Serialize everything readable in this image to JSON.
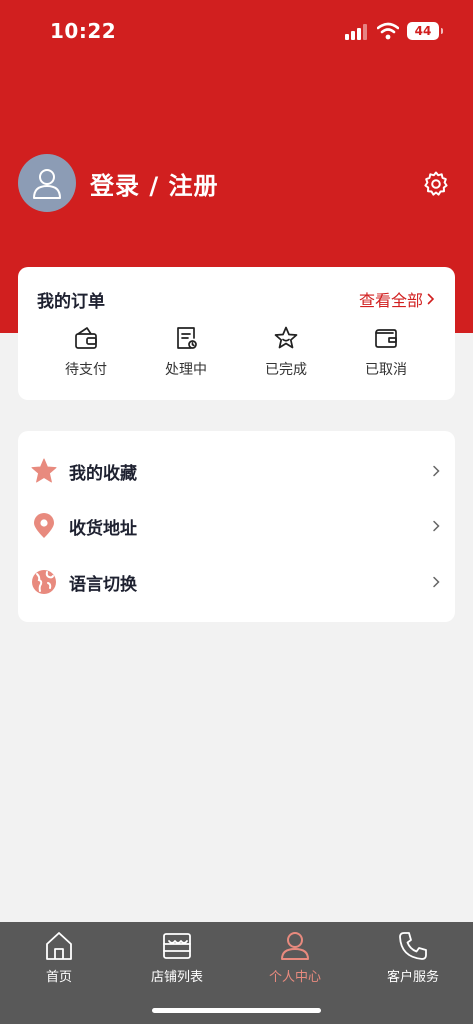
{
  "status_bar": {
    "time": "10:22",
    "battery": "44"
  },
  "profile": {
    "login_label": "登录 / 注册"
  },
  "orders": {
    "title": "我的订单",
    "view_all": "查看全部",
    "items": [
      {
        "label": "待支付",
        "icon": "wallet-icon"
      },
      {
        "label": "处理中",
        "icon": "document-icon"
      },
      {
        "label": "已完成",
        "icon": "star-icon"
      },
      {
        "label": "已取消",
        "icon": "wallet-cancel-icon"
      }
    ]
  },
  "menu": {
    "items": [
      {
        "label": "我的收藏",
        "icon": "star-icon"
      },
      {
        "label": "收货地址",
        "icon": "location-pin-icon"
      },
      {
        "label": "语言切换",
        "icon": "globe-icon"
      }
    ]
  },
  "tabbar": {
    "tabs": [
      {
        "label": "首页",
        "icon": "home-icon"
      },
      {
        "label": "店铺列表",
        "icon": "store-icon"
      },
      {
        "label": "个人中心",
        "icon": "user-icon",
        "active": true
      },
      {
        "label": "客户服务",
        "icon": "phone-icon"
      }
    ]
  },
  "colors": {
    "brand_red": "#d11f1f",
    "accent_salmon": "#e88a7e",
    "tabbar_bg": "#595959"
  }
}
